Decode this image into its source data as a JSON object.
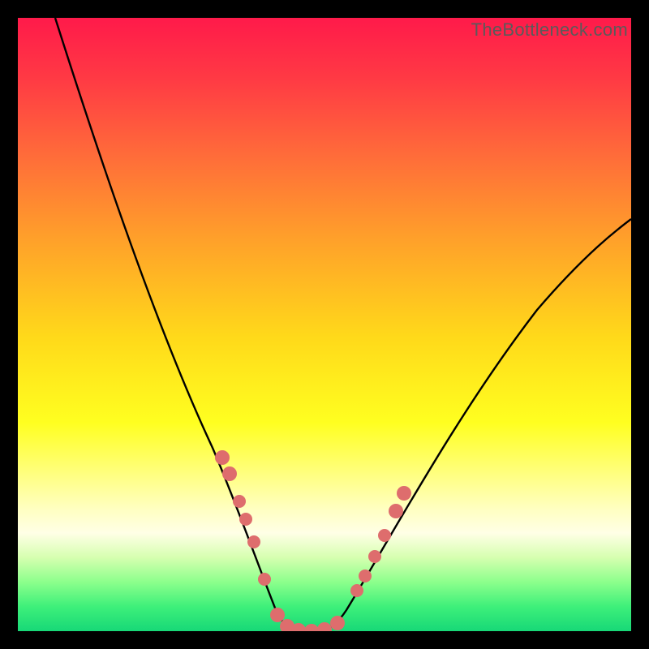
{
  "watermark": "TheBottleneck.com",
  "chart_data": {
    "type": "line",
    "title": "",
    "xlabel": "",
    "ylabel": "",
    "xlim": [
      0,
      100
    ],
    "ylim": [
      0,
      100
    ],
    "series": [
      {
        "name": "bottleneck-curve",
        "x": [
          0,
          5,
          10,
          15,
          20,
          25,
          28,
          30,
          32,
          35,
          38,
          40,
          42,
          44,
          46,
          48,
          50,
          55,
          60,
          65,
          70,
          75,
          80,
          85,
          90,
          95,
          100
        ],
        "values": [
          100,
          92,
          83,
          73,
          62,
          50,
          42,
          36,
          30,
          22,
          13,
          8,
          4,
          1,
          0,
          1,
          4,
          13,
          23,
          31,
          39,
          46,
          52,
          58,
          63,
          67,
          70
        ]
      }
    ],
    "markers": {
      "name": "highlighted-points",
      "color": "#de6d6d",
      "x": [
        31,
        33,
        34.5,
        36,
        38,
        41,
        43,
        44.5,
        46,
        47,
        48,
        52,
        53.5,
        55,
        56.5,
        58,
        58.5
      ],
      "values": [
        33,
        27,
        24,
        21,
        14,
        5,
        1,
        0.5,
        0,
        0.5,
        1,
        8,
        11,
        14,
        17,
        20,
        21
      ]
    },
    "background_gradient": {
      "top": "#ff1a4a",
      "mid": "#ffd91a",
      "bottom": "#17d877"
    }
  }
}
